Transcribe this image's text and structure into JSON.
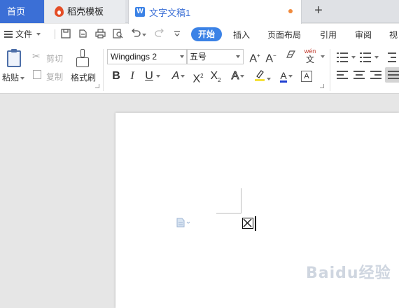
{
  "tabs": {
    "home": "首页",
    "templates": "稻壳模板",
    "document": "文字文稿1"
  },
  "menu": {
    "file": "文件",
    "start": "开始",
    "insert": "插入",
    "layout": "页面布局",
    "references": "引用",
    "review": "审阅",
    "view": "视"
  },
  "ribbon": {
    "paste": "粘贴",
    "cut": "剪切",
    "copy": "复制",
    "format_painter": "格式刷",
    "font_name": "Wingdings 2",
    "font_size": "五号",
    "pinyin": "wén"
  },
  "document": {
    "symbol": "☒"
  },
  "watermark": "Baidu经验",
  "colors": {
    "accent": "#3b82e6",
    "home_tab": "#3b6fd6",
    "highlight": "#f5e13a",
    "font_color": "#1f3fd1"
  }
}
